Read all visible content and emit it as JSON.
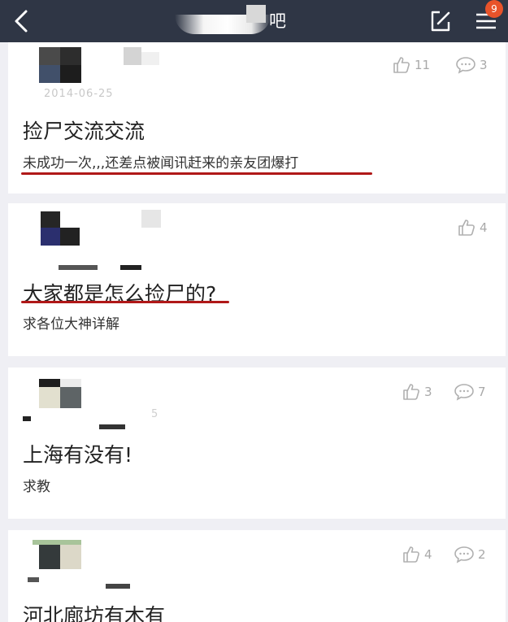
{
  "header": {
    "title": "吧",
    "badge": "9"
  },
  "posts": [
    {
      "date": "2014-06-25",
      "likes": "11",
      "comments": "3",
      "title": "捡尸交流交流",
      "subtitle": "未成功一次,,,还差点被闻讯赶来的亲友团爆打"
    },
    {
      "likes": "4",
      "title": "大家都是怎么捡尸的?",
      "subtitle": "求各位大神详解"
    },
    {
      "date": "5",
      "likes": "3",
      "comments": "7",
      "title": "上海有没有!",
      "subtitle": "求教"
    },
    {
      "likes": "4",
      "comments": "2",
      "title": "河北廊坊有木有"
    }
  ],
  "colors": {
    "header_bg": "#2f3645",
    "badge": "#e8532a",
    "underline": "#b01818"
  }
}
